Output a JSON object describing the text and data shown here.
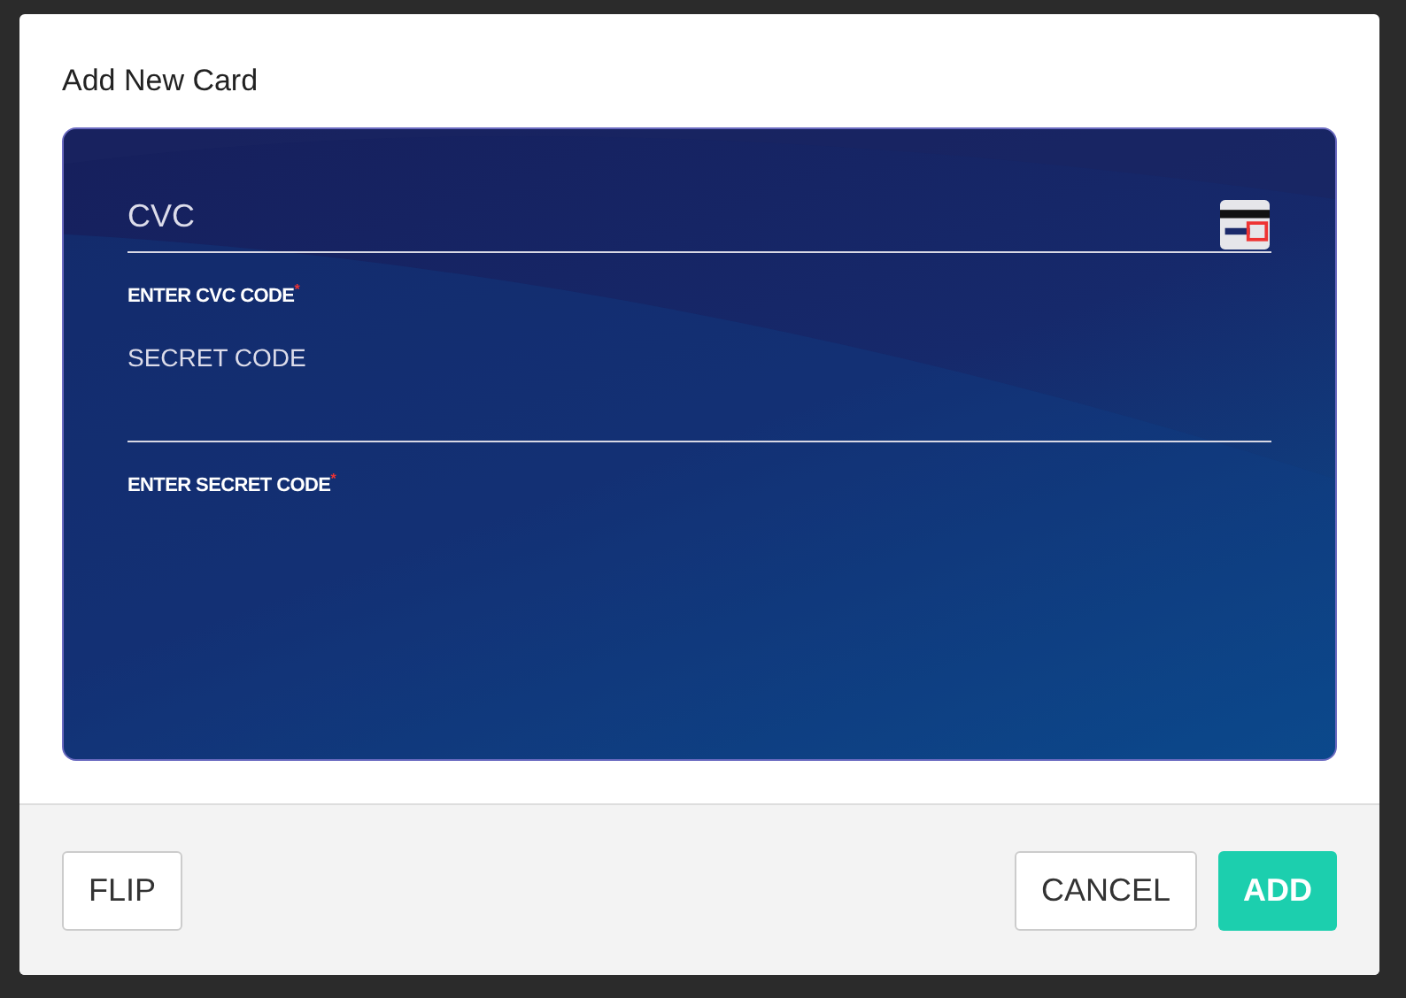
{
  "dialog": {
    "title": "Add New Card"
  },
  "card_fields": [
    {
      "kind": "placeholder",
      "placeholder": "CVC",
      "helper": "ENTER CVC CODE",
      "required_mark": "*",
      "card_icon": true
    },
    {
      "kind": "label",
      "label": "SECRET CODE",
      "helper": "ENTER SECRET CODE",
      "required_mark": "*",
      "card_icon": false
    }
  ],
  "left_buttons": [
    {
      "label": "FLIP",
      "kind": "outline"
    }
  ],
  "right_buttons": [
    {
      "label": "CANCEL",
      "kind": "outline"
    },
    {
      "label": "ADD",
      "kind": "primary"
    }
  ]
}
